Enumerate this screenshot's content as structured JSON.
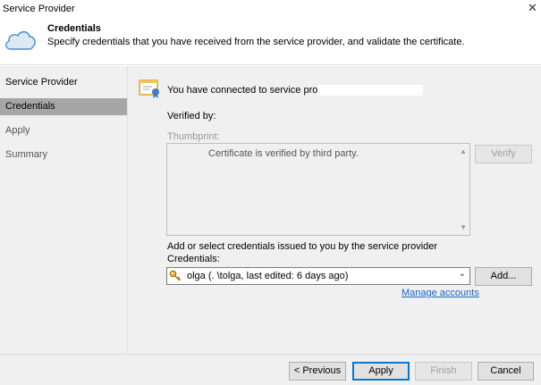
{
  "window": {
    "title": "Service Provider",
    "close_glyph": "✕"
  },
  "header": {
    "title": "Credentials",
    "description": "Specify credentials that you have received from the service provider, and validate the certificate.",
    "icon": "cloud-icon"
  },
  "sidebar": {
    "items": [
      {
        "label": "Service Provider"
      },
      {
        "label": "Credentials"
      },
      {
        "label": "Apply"
      },
      {
        "label": "Summary"
      }
    ],
    "active_index": 1
  },
  "certificate": {
    "icon": "certificate-icon",
    "connected_text": "You have connected to service provider",
    "verified_label": "Verified by:",
    "verified_value": "",
    "thumbprint_label": "Thumbprint:",
    "thumbprint_text": "Certificate is verified by third party.",
    "verify_button": "Verify"
  },
  "credentials": {
    "instruction": "Add or select credentials issued to you by the service provider",
    "label": "Credentials:",
    "selected_value": "olga (.                \\tolga, last edited: 6 days ago)",
    "add_button": "Add...",
    "manage_link": "Manage accounts",
    "icon": "key-icon"
  },
  "footer": {
    "previous": "< Previous",
    "apply": "Apply",
    "finish": "Finish",
    "cancel": "Cancel"
  },
  "colors": {
    "accent": "#0078d7",
    "link": "#1a64c8",
    "sidebar_active": "#a6a6a6",
    "panel_bg": "#f0f0f0"
  }
}
